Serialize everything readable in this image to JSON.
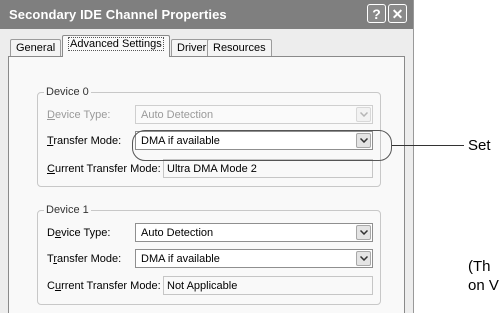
{
  "dialog": {
    "title": "Secondary IDE Channel Properties",
    "help_label": "?",
    "close_label": "✕"
  },
  "tabs": [
    {
      "label": "General",
      "active": false
    },
    {
      "label": "Advanced Settings",
      "active": true
    },
    {
      "label": "Driver",
      "active": false
    },
    {
      "label": "Resources",
      "active": false
    }
  ],
  "device0": {
    "group_title": "Device 0",
    "device_type": {
      "hotkey": "D",
      "rest": "evice Type:",
      "value": "Auto Detection",
      "enabled": false
    },
    "transfer_mode": {
      "hotkey": "T",
      "rest": "ransfer Mode:",
      "value": "DMA if available",
      "enabled": true
    },
    "current_mode": {
      "hotkey": "C",
      "rest": "urrent Transfer Mode:",
      "value": "Ultra DMA Mode 2"
    }
  },
  "device1": {
    "group_title": "Device 1",
    "device_type": {
      "pre": "D",
      "hotkey": "e",
      "rest": "vice Type:",
      "value": "Auto Detection",
      "enabled": true
    },
    "transfer_mode": {
      "pre": "T",
      "hotkey": "r",
      "rest": "ansfer Mode:",
      "value": "DMA if available",
      "enabled": true
    },
    "current_mode": {
      "pre": "C",
      "hotkey": "u",
      "rest": "rrent Transfer Mode:",
      "value": "Not Applicable"
    }
  },
  "annotations": {
    "callout_1": "Set",
    "callout_2_line1": "(Th",
    "callout_2_line2": "on V"
  },
  "colors": {
    "titlebar": "#7f7f7f",
    "dialog_bg": "#ededed",
    "panel_bg": "#f9f9f9"
  },
  "icons": {
    "dropdown": "chevron-down-icon",
    "help": "help-icon",
    "close": "close-icon"
  }
}
